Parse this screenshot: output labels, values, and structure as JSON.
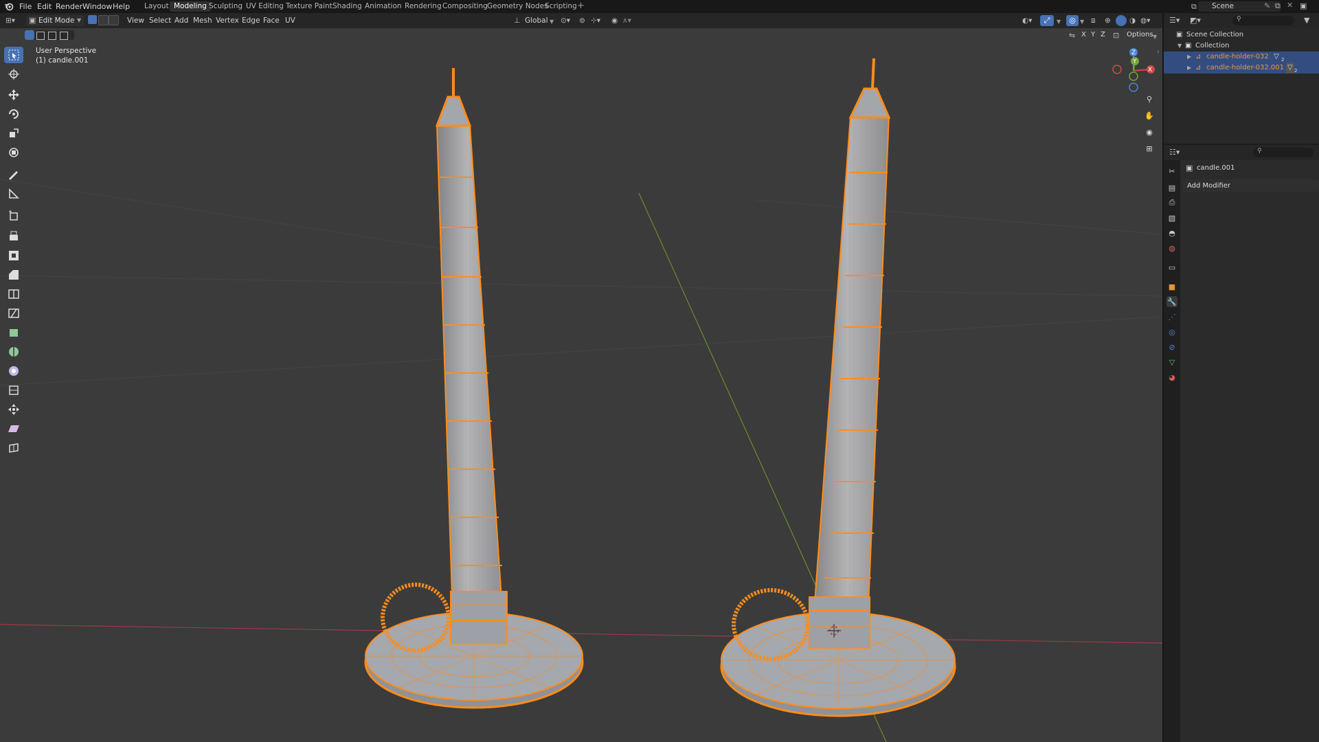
{
  "topbar": {
    "menus": [
      "File",
      "Edit",
      "Render",
      "Window",
      "Help"
    ],
    "workspace_tabs": [
      "Layout",
      "Modeling",
      "Sculpting",
      "UV Editing",
      "Texture Paint",
      "Shading",
      "Animation",
      "Rendering",
      "Compositing",
      "Geometry Nodes",
      "Scripting"
    ],
    "active_workspace": "Modeling",
    "add_tab": "+",
    "scene_name": "Scene"
  },
  "viewport_header": {
    "mode": "Edit Mode",
    "menus": [
      "View",
      "Select",
      "Add",
      "Mesh",
      "Vertex",
      "Edge",
      "Face",
      "UV"
    ],
    "orientation": "Global",
    "axes": [
      "X",
      "Y",
      "Z"
    ],
    "options": "Options"
  },
  "viewport": {
    "perspective_label": "User Perspective",
    "object_label": "(1) candle.001",
    "gizmo": {
      "x": "X",
      "y": "Y",
      "z": "Z"
    },
    "colors": {
      "background": "#3b3b3b",
      "selection": "#ff8c1a",
      "mesh": "#9a9da3",
      "x_axis": "#9c3b45",
      "y_axis": "#6f8a2c"
    }
  },
  "outliner": {
    "scene_collection": "Scene Collection",
    "collection": "Collection",
    "items": [
      {
        "name": "candle-holder-032",
        "badge": "2"
      },
      {
        "name": "candle-holder-032.001",
        "badge": "2"
      }
    ]
  },
  "properties": {
    "object_name": "candle.001",
    "add_modifier": "Add Modifier"
  }
}
